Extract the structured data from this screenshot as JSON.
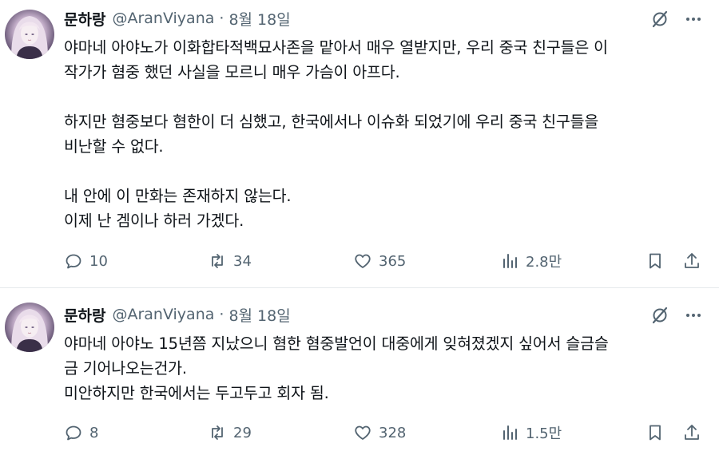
{
  "tweets": [
    {
      "author_name": "문하랑",
      "handle": "@AranViyana",
      "separator": "·",
      "date": "8월 18일",
      "lines": [
        "야마네 아야노가 이화합타적백묘사존을 맡아서 매우 열받지만, 우리 중국 친구들은 이",
        "작가가 혐중 했던 사실을 모르니 매우 가슴이 아프다.",
        "",
        "하지만 혐중보다 혐한이 더 심했고, 한국에서나 이슈화 되었기에 우리 중국 친구들을",
        "비난할 수 없다.",
        "",
        "내 안에 이 만화는 존재하지 않는다.",
        "이제 난 겜이나 하러 가겠다."
      ],
      "replies": "10",
      "reposts": "34",
      "likes": "365",
      "views": "2.8만"
    },
    {
      "author_name": "문하랑",
      "handle": "@AranViyana",
      "separator": "·",
      "date": "8월 18일",
      "lines": [
        "야마네 아야노 15년쯤 지났으니 혐한 혐중발언이 대중에게 잊혀졌겠지 싶어서 슬금슬",
        "금 기어나오는건가.",
        "미안하지만 한국에서는 두고두고 회자 됨."
      ],
      "replies": "8",
      "reposts": "29",
      "likes": "328",
      "views": "1.5만"
    }
  ],
  "icons": {
    "avatar": "anime-character-avatar",
    "grok": "grok-icon",
    "more": "more-icon",
    "reply": "reply-icon",
    "repost": "repost-icon",
    "like": "heart-icon",
    "views": "views-icon",
    "bookmark": "bookmark-icon",
    "share": "share-icon"
  },
  "colors": {
    "text": "#0f1419",
    "secondary": "#536471",
    "divider": "#e6e9ec"
  }
}
